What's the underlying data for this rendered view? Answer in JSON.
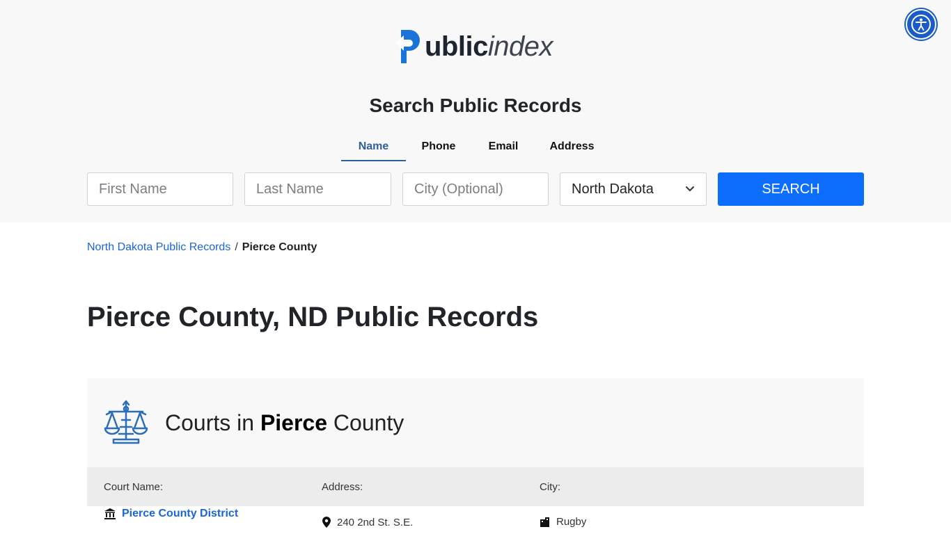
{
  "logo": {
    "bold": "ublic",
    "light": "index"
  },
  "search": {
    "title": "Search Public Records",
    "tabs": [
      {
        "label": "Name",
        "active": true
      },
      {
        "label": "Phone",
        "active": false
      },
      {
        "label": "Email",
        "active": false
      },
      {
        "label": "Address",
        "active": false
      }
    ],
    "first_name_placeholder": "First Name",
    "last_name_placeholder": "Last Name",
    "city_placeholder": "City (Optional)",
    "state_selected": "North Dakota",
    "button_label": "SEARCH"
  },
  "breadcrumb": {
    "parent": "North Dakota Public Records",
    "separator": "/",
    "current": "Pierce County"
  },
  "page": {
    "title": "Pierce County, ND Public Records"
  },
  "courts": {
    "title_pre": "Courts in ",
    "title_bold": "Pierce",
    "title_post": " County",
    "columns": [
      "Court Name:",
      "Address:",
      "City:"
    ],
    "rows": [
      {
        "name": "Pierce County District",
        "address": "240 2nd St. S.E.",
        "city": "Rugby"
      }
    ]
  },
  "colors": {
    "accent": "#0d6efd",
    "link": "#1a66d6",
    "tab_active": "#2d5f9e",
    "header_bg": "#f8f8f8"
  }
}
